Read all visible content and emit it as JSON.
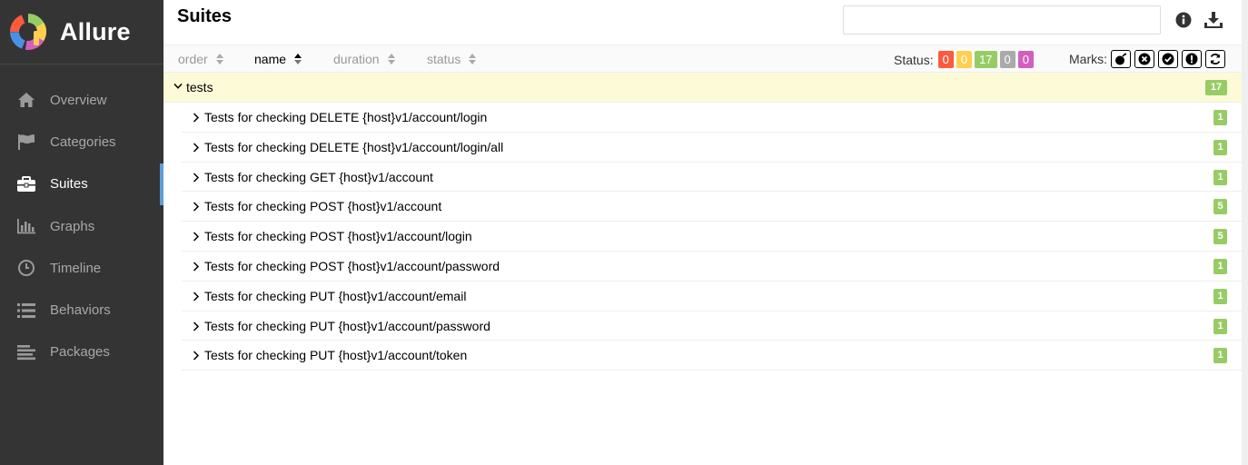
{
  "app": {
    "name": "Allure"
  },
  "sidebar": {
    "items": [
      {
        "label": "Overview",
        "icon": "home-icon",
        "active": false
      },
      {
        "label": "Categories",
        "icon": "flag-icon",
        "active": false
      },
      {
        "label": "Suites",
        "icon": "briefcase-icon",
        "active": true
      },
      {
        "label": "Graphs",
        "icon": "bar-chart-icon",
        "active": false
      },
      {
        "label": "Timeline",
        "icon": "clock-icon",
        "active": false
      },
      {
        "label": "Behaviors",
        "icon": "list-icon",
        "active": false
      },
      {
        "label": "Packages",
        "icon": "align-left-icon",
        "active": false
      }
    ]
  },
  "header": {
    "title": "Suites",
    "search": {
      "value": "",
      "placeholder": ""
    },
    "icons": [
      "info-icon",
      "download-icon"
    ]
  },
  "sort": {
    "columns": [
      {
        "label": "order",
        "active": false
      },
      {
        "label": "name",
        "active": true
      },
      {
        "label": "duration",
        "active": false
      },
      {
        "label": "status",
        "active": false
      }
    ]
  },
  "status_filter": {
    "label": "Status:",
    "items": [
      {
        "name": "failed",
        "count": "0",
        "color": "#fd5a3e"
      },
      {
        "name": "broken",
        "count": "0",
        "color": "#ffd050"
      },
      {
        "name": "passed",
        "count": "17",
        "color": "#97cc64"
      },
      {
        "name": "skipped",
        "count": "0",
        "color": "#aaaaaa"
      },
      {
        "name": "unknown",
        "count": "0",
        "color": "#d35ebe"
      }
    ]
  },
  "marks": {
    "label": "Marks:",
    "icons": [
      "bomb-icon",
      "close-circle-icon",
      "check-circle-icon",
      "exclamation-icon",
      "refresh-icon"
    ]
  },
  "tree": {
    "group": {
      "name": "tests",
      "count": "17"
    },
    "children": [
      {
        "name": "Tests for checking DELETE {host}v1/account/login",
        "count": "1"
      },
      {
        "name": "Tests for checking DELETE {host}v1/account/login/all",
        "count": "1"
      },
      {
        "name": "Tests for checking GET {host}v1/account",
        "count": "1"
      },
      {
        "name": "Tests for checking POST {host}v1/account",
        "count": "5"
      },
      {
        "name": "Tests for checking POST {host}v1/account/login",
        "count": "5"
      },
      {
        "name": "Tests for checking POST {host}v1/account/password",
        "count": "1"
      },
      {
        "name": "Tests for checking PUT {host}v1/account/email",
        "count": "1"
      },
      {
        "name": "Tests for checking PUT {host}v1/account/password",
        "count": "1"
      },
      {
        "name": "Tests for checking PUT {host}v1/account/token",
        "count": "1"
      }
    ]
  }
}
